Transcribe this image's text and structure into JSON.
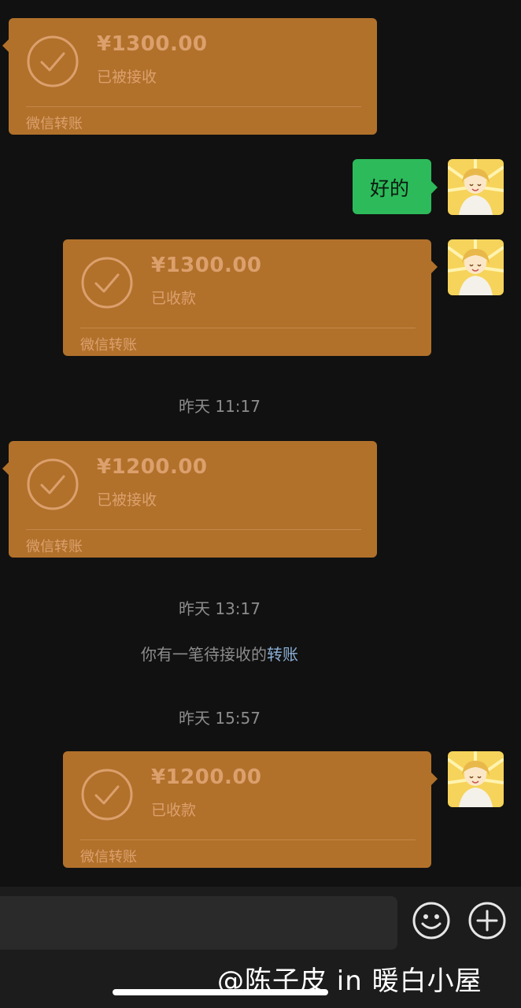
{
  "messages": [
    {
      "type": "transfer",
      "side": "left",
      "amount": "¥1300.00",
      "status": "已被接收",
      "brand": "微信转账"
    },
    {
      "type": "text",
      "side": "right",
      "text": "好的"
    },
    {
      "type": "transfer",
      "side": "right",
      "amount": "¥1300.00",
      "status": "已收款",
      "brand": "微信转账"
    },
    {
      "type": "time",
      "text": "昨天 11:17"
    },
    {
      "type": "transfer",
      "side": "left",
      "amount": "¥1200.00",
      "status": "已被接收",
      "brand": "微信转账"
    },
    {
      "type": "time",
      "text": "昨天 13:17"
    },
    {
      "type": "system",
      "text": "你有一笔待接收的",
      "link": "转账"
    },
    {
      "type": "time",
      "text": "昨天 15:57"
    },
    {
      "type": "transfer",
      "side": "right",
      "amount": "¥1200.00",
      "status": "已收款",
      "brand": "微信转账"
    }
  ],
  "input_bar": {
    "emoji_icon": "emoji-icon",
    "more_icon": "plus-icon"
  },
  "watermark": "@陈子皮 in 暖白小屋",
  "colors": {
    "transfer_bg": "#b1712b",
    "transfer_text": "#dca06d",
    "bubble_green": "#2dba5a",
    "background": "#111111",
    "link": "#8bb0d6"
  }
}
